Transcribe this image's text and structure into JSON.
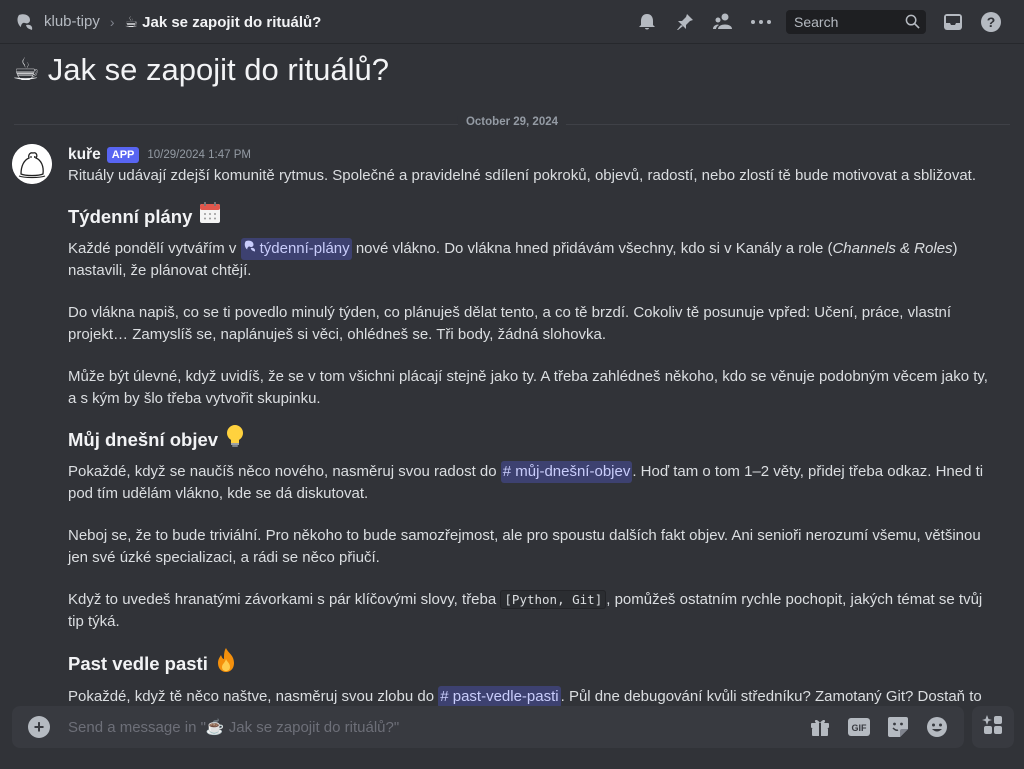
{
  "header": {
    "channel_icon": "threads-icon",
    "parent": "klub-tipy",
    "separator": "›",
    "current": "☕ Jak se zapojit do rituálů?",
    "search_placeholder": "Search"
  },
  "page_title": {
    "emoji": "☕",
    "text": "Jak se zapojit do rituálů?"
  },
  "date_divider": "October 29, 2024",
  "message": {
    "author": "kuře",
    "badge": "APP",
    "timestamp": "10/29/2024 1:47 PM",
    "intro": "Rituály udávají zdejší komunitě rytmus. Společné a pravidelné sdílení pokroků, objevů, radostí, nebo zlostí tě bude motivovat a sbližovat.",
    "sections": [
      {
        "heading": "Týdenní plány",
        "emoji": "🗓️",
        "p1_before": "Každé pondělí vytvářím v ",
        "p1_mention": "týdenní-plány",
        "p1_after": " nové vlákno. Do vlákna hned přidávám všechny, kdo si v Kanály a role (",
        "p1_em": "Channels & Roles",
        "p1_end": ") nastavili, že plánovat chtějí.",
        "p2": "Do vlákna napiš, co se ti povedlo minulý týden, co plánuješ dělat tento, a co tě brzdí. Cokoliv tě posunuje vpřed: Učení, práce, vlastní projekt… Zamyslíš se, naplánuješ si věci, ohlédneš se. Tři body, žádná slohovka.",
        "p3": "Může být úlevné, když uvidíš, že se v tom všichni plácají stejně jako ty. A třeba zahlédneš někoho, kdo se věnuje podobným věcem jako ty, a s kým by šlo třeba vytvořit skupinku."
      },
      {
        "heading": "Můj dnešní objev",
        "emoji": "💡",
        "p1_before": "Pokaždé, když se naučíš něco nového, nasměruj svou radost do ",
        "p1_mention": "# můj-dnešní-objev",
        "p1_after": ". Hoď tam o tom 1–2 věty, přidej třeba odkaz. Hned ti pod tím udělám vlákno, kde se dá diskutovat.",
        "p2": "Neboj se, že to bude triviální. Pro někoho to bude samozřejmost, ale pro spoustu dalších fakt objev. Ani senioři nerozumí všemu, většinou jen své úzké specializaci, a rádi se něco přiučí.",
        "p3_before": "Když to uvedeš hranatými závorkami s pár klíčovými slovy, třeba ",
        "p3_code": "[Python, Git]",
        "p3_after": ", pomůžeš ostatním rychle pochopit, jakých témat se tvůj tip týká."
      },
      {
        "heading": "Past vedle pasti",
        "emoji": "🔥",
        "p1_before": "Pokaždé, když tě něco naštve, nasměruj svou zlobu do ",
        "p1_mention": "# past-vedle-pasti",
        "p1_after": ". Půl dne debugování kvůli středníku? Zamotaný Git? Dostaň to"
      }
    ]
  },
  "composer": {
    "placeholder": "Send a message in \"☕ Jak se zapojit do rituálů?\""
  },
  "colors": {
    "background": "#313338",
    "mention_bg": "#4a4f8c",
    "badge": "#5865f2"
  }
}
